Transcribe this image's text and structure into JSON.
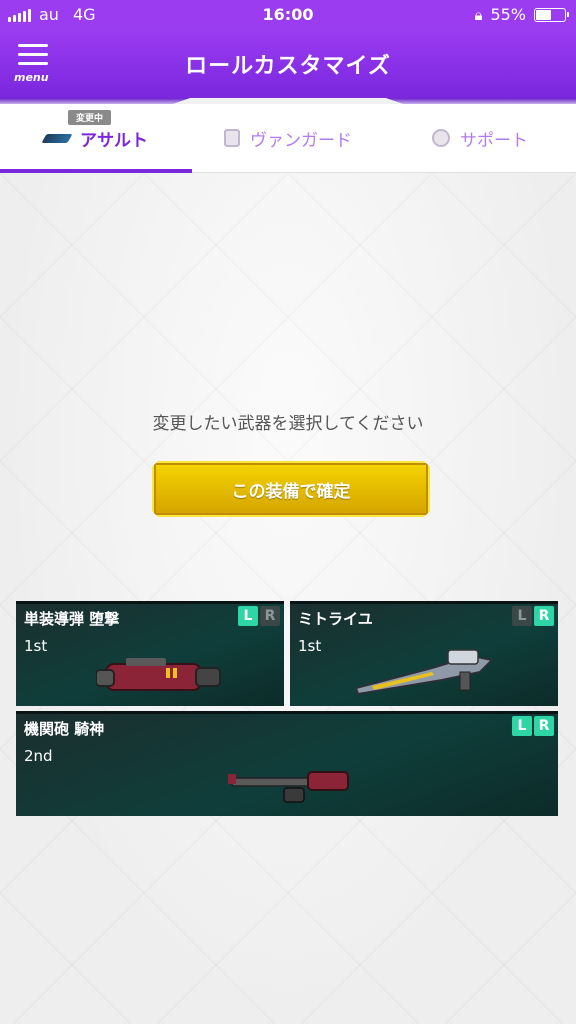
{
  "status_bar": {
    "carrier": "au",
    "network": "4G",
    "time": "16:00",
    "battery": "55%",
    "battery_level": 0.55
  },
  "header": {
    "menu_label": "menu",
    "title": "ロールカスタマイズ"
  },
  "tabs": [
    {
      "label": "アサルト",
      "badge": "変更中",
      "active": true
    },
    {
      "label": "ヴァンガード",
      "active": false
    },
    {
      "label": "サポート",
      "active": false
    }
  ],
  "main": {
    "prompt": "変更したい武器を選択してください",
    "confirm_label": "この装備で確定"
  },
  "weapons": [
    {
      "name": "単装導弾 堕撃",
      "rank": "1st",
      "l": "L",
      "r": "R",
      "l_active": true,
      "r_active": false
    },
    {
      "name": "ミトライユ",
      "rank": "1st",
      "l": "L",
      "r": "R",
      "l_active": false,
      "r_active": true
    },
    {
      "name": "機関砲 騎神",
      "rank": "2nd",
      "l": "L",
      "r": "R",
      "l_active": true,
      "r_active": true
    }
  ],
  "colors": {
    "accent": "#7a27de",
    "header": "#9a3cf2",
    "confirm": "#e8c000",
    "card": "#0f3e3a",
    "lr_active": "#2fd6a5"
  }
}
